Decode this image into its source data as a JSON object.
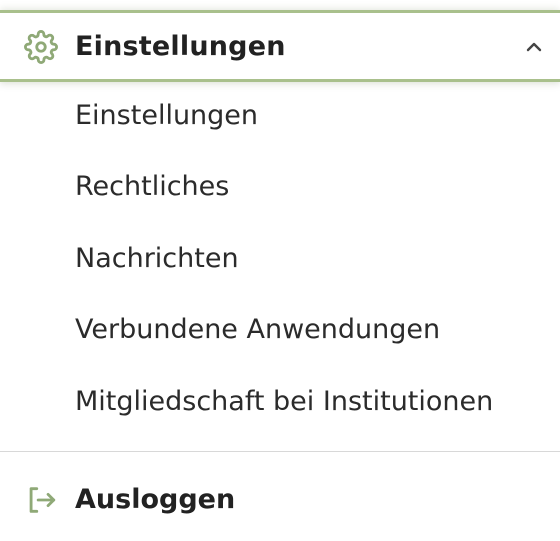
{
  "colors": {
    "accent": "#8fa977",
    "accent_border": "#a9c08c",
    "text": "#222222",
    "divider": "#d8d8d8"
  },
  "settings_section": {
    "title": "Einstellungen",
    "icon": "gear-icon",
    "toggle_icon": "chevron-up-icon",
    "items": [
      {
        "label": "Einstellungen"
      },
      {
        "label": "Rechtliches"
      },
      {
        "label": "Nachrichten"
      },
      {
        "label": "Verbundene Anwendungen"
      },
      {
        "label": "Mitgliedschaft bei Institutionen"
      }
    ]
  },
  "logout": {
    "label": "Ausloggen",
    "icon": "logout-icon"
  }
}
